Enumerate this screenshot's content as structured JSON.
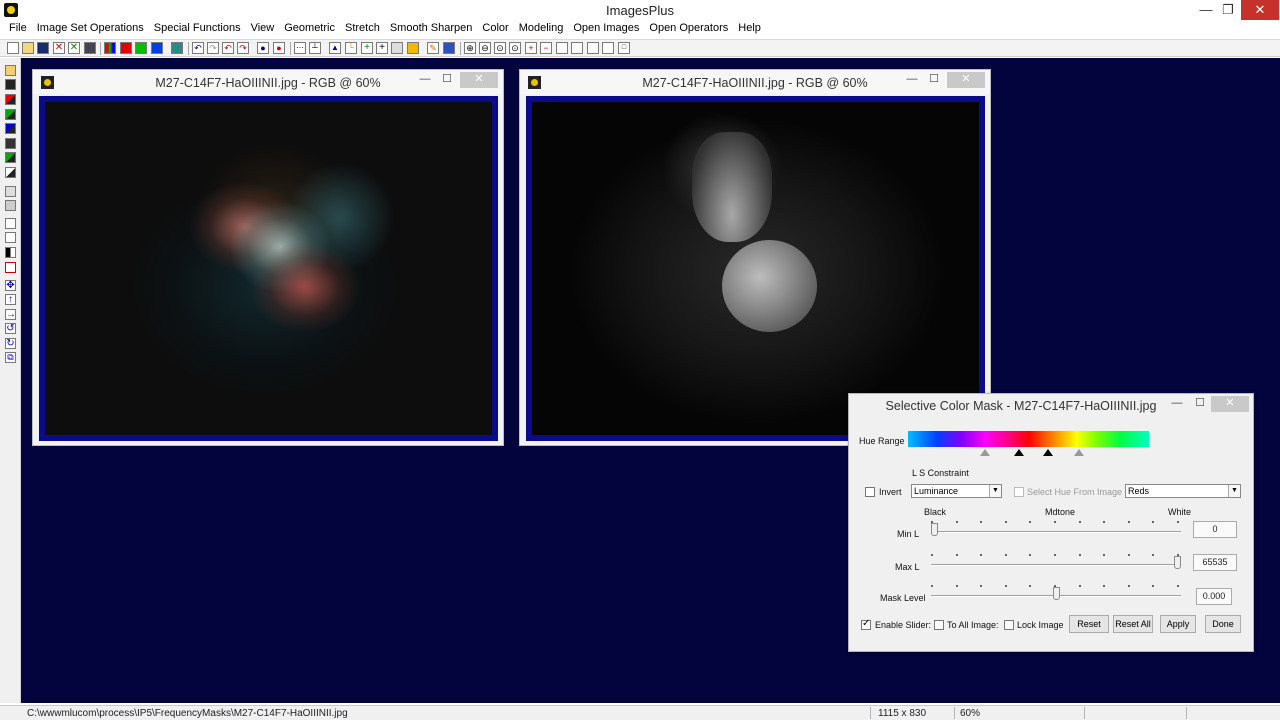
{
  "app": {
    "title": "ImagesPlus"
  },
  "window_controls": {
    "minimize": "—",
    "maximize": "❐",
    "close": "✕"
  },
  "menu": [
    "File",
    "Image Set Operations",
    "Special Functions",
    "View",
    "Geometric",
    "Stretch",
    "Smooth Sharpen",
    "Color",
    "Modeling",
    "Open Images",
    "Open Operators",
    "Help"
  ],
  "child_windows": [
    {
      "title": "M27-C14F7-HaOIIINII.jpg - RGB @ 60%"
    },
    {
      "title": "M27-C14F7-HaOIIINII.jpg - RGB @ 60%"
    }
  ],
  "child_controls": {
    "minimize": "—",
    "maximize": "☐",
    "close": "✕"
  },
  "dialog": {
    "title": "Selective Color Mask - M27-C14F7-HaOIIINII.jpg",
    "hue_range_label": "Hue Range",
    "ls_constraint_label": "L S Constraint",
    "invert_label": "Invert",
    "invert_checked": false,
    "ls_constraint_value": "Luminance",
    "select_hue_from_image_label": "Select Hue From Image",
    "select_hue_from_image_checked": false,
    "hue_preset_value": "Reds",
    "scale_labels": {
      "black": "Black",
      "mdtone": "Mdtone",
      "white": "White"
    },
    "min_l": {
      "label": "Min L",
      "value": "0",
      "fraction": 0.0
    },
    "max_l": {
      "label": "Max L",
      "value": "65535",
      "fraction": 1.0
    },
    "mask_level": {
      "label": "Mask Level",
      "value": "0.000",
      "fraction": 0.5
    },
    "enable_sliders_label": "Enable Slider:",
    "enable_sliders_checked": true,
    "to_all_images_label": "To All Image:",
    "to_all_images_checked": false,
    "lock_image_label": "Lock Image",
    "lock_image_checked": false,
    "buttons": {
      "reset": "Reset",
      "reset_all": "Reset All",
      "apply": "Apply",
      "done": "Done"
    }
  },
  "status": {
    "path": "C:\\wwwmlucom\\process\\IP5\\FrequencyMasks\\M27-C14F7-HaOIIINII.jpg",
    "dimensions": "1115 x 830",
    "zoom": "60%"
  }
}
